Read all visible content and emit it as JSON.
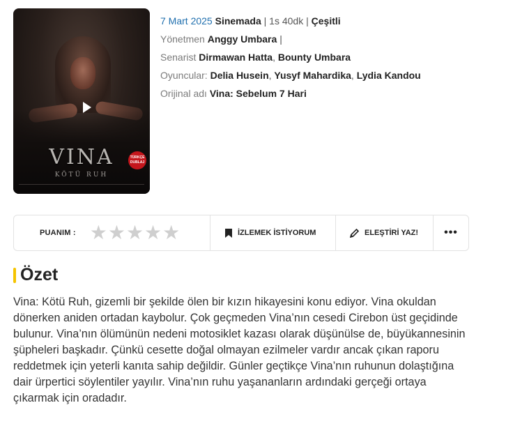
{
  "poster": {
    "title": "VINA",
    "subtitle": "KÖTÜ RUH",
    "badge": "TÜRKÇE DUBLAJ"
  },
  "meta": {
    "date": "7 Mart 2025",
    "release": "Sinemada",
    "duration": "1s 40dk",
    "genre": "Çeşitli",
    "director_label": "Yönetmen",
    "director": "Anggy Umbara",
    "writer_label": "Senarist",
    "writers": [
      "Dirmawan Hatta",
      "Bounty Umbara"
    ],
    "cast_label": "Oyuncular:",
    "cast": [
      "Delia Husein",
      "Yusyf Mahardika",
      "Lydia Kandou"
    ],
    "original_label": "Orijinal adı",
    "original_title": "Vina: Sebelum 7 Hari"
  },
  "actions": {
    "rating_label": "PUANIM :",
    "rating_value": 0,
    "rating_max": 5,
    "watchlist_label": "İZLEMEK İSTİYORUM",
    "review_label": "ELEŞTİRİ YAZ!",
    "more_label": "•••"
  },
  "summary": {
    "heading": "Özet",
    "text": "Vina: Kötü Ruh, gizemli bir şekilde ölen bir kızın hikayesini konu ediyor. Vina okuldan dönerken aniden ortadan kaybolur. Çok geçmeden Vina’nın cesedi Cirebon üst geçidinde bulunur. Vina’nın ölümünün nedeni motosiklet kazası olarak düşünülse de, büyükannesinin şüpheleri başkadır. Çünkü cesette doğal olmayan ezilmeler vardır ancak çıkan raporu reddetmek için yeterli kanıta sahip değildir. Günler geçtikçe Vina’nın ruhunun dolaştığına dair ürpertici söylentiler yayılır. Vina’nın ruhu yaşananların ardındaki gerçeği ortaya çıkarmak için oradadır."
  },
  "colors": {
    "date_blue": "#1f6fae",
    "accent_yellow": "#f5c400",
    "star_empty": "#cfcfcf"
  }
}
